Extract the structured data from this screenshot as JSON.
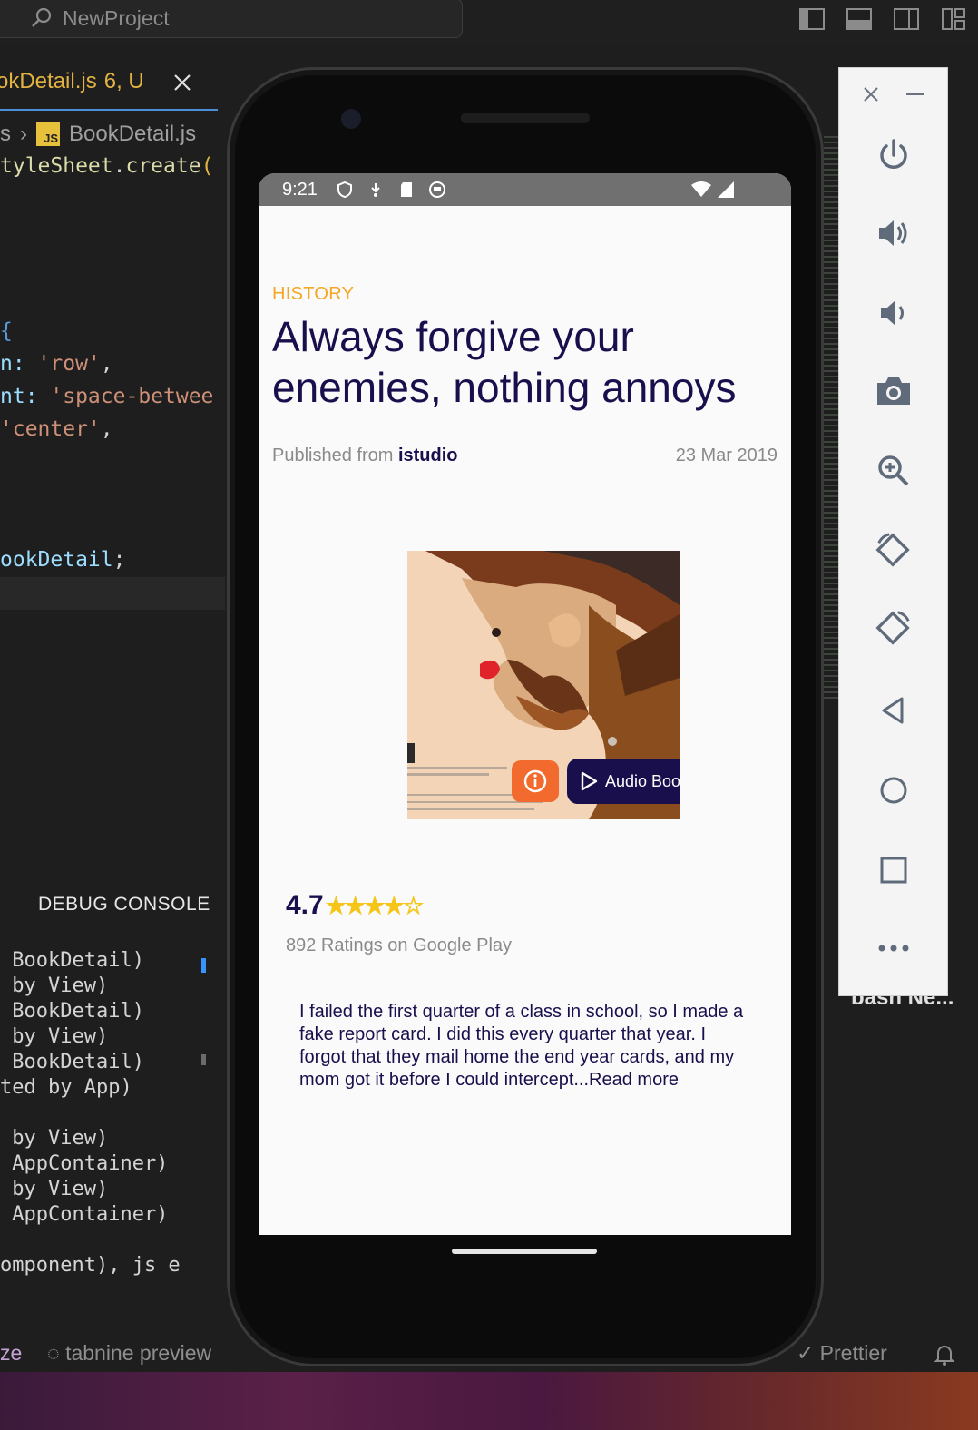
{
  "editor": {
    "search_text": "NewProject",
    "tab": {
      "name": "okDetail.js",
      "status": "6, U"
    },
    "breadcrumb": {
      "prefix": "s",
      "file": "BookDetail.js",
      "js_badge": "JS"
    },
    "code": {
      "l1_a": "tyleSheet",
      "l1_b": ".",
      "l1_c": "create",
      "l1_d": "(",
      "l2": "{",
      "l3_a": "n: ",
      "l3_b": "'row'",
      "l3_c": ",",
      "l4_a": "nt: ",
      "l4_b": "'space-betwee",
      "l5_a": "'center'",
      "l5_b": ",",
      "l6_a": "ookDetail",
      "l6_b": ";"
    },
    "panel_title": "DEBUG CONSOLE",
    "console_lines": [
      " BookDetail)",
      " by View)",
      " BookDetail)",
      " by View)",
      " BookDetail)",
      "ted by App)",
      " by View)",
      " AppContainer)",
      " by View)",
      " AppContainer)",
      "omponent), js e"
    ],
    "status": {
      "left": "ze",
      "tabnine": "tabnine preview",
      "prettier": "Prettier"
    },
    "terminal_tab": "bash Ne..."
  },
  "phone": {
    "status_time": "9:21",
    "category": "HISTORY",
    "title": "Always forgive your enemies, nothing annoys",
    "published_prefix": "Published from ",
    "publisher": "istudio",
    "date": "23 Mar 2019",
    "audio_button": "Audio Book",
    "rating_value": "4.7",
    "stars": "★★★★☆",
    "rating_sub": "892 Ratings on Google Play",
    "review": "I failed the first quarter of a class in school, so I made a fake report card. I did this every quarter that year. I forgot that they mail home the end year cards, and my mom got it before I could intercept...Read more"
  },
  "emulator_tools": [
    "power-icon",
    "volume-up-icon",
    "volume-down-icon",
    "camera-icon",
    "zoom-icon",
    "rotate-left-icon",
    "rotate-right-icon",
    "back-icon",
    "home-icon",
    "overview-icon",
    "more-icon"
  ],
  "colors": {
    "accent": "#f5a623",
    "title": "#1a0f4d",
    "info_button": "#f26a2e"
  }
}
